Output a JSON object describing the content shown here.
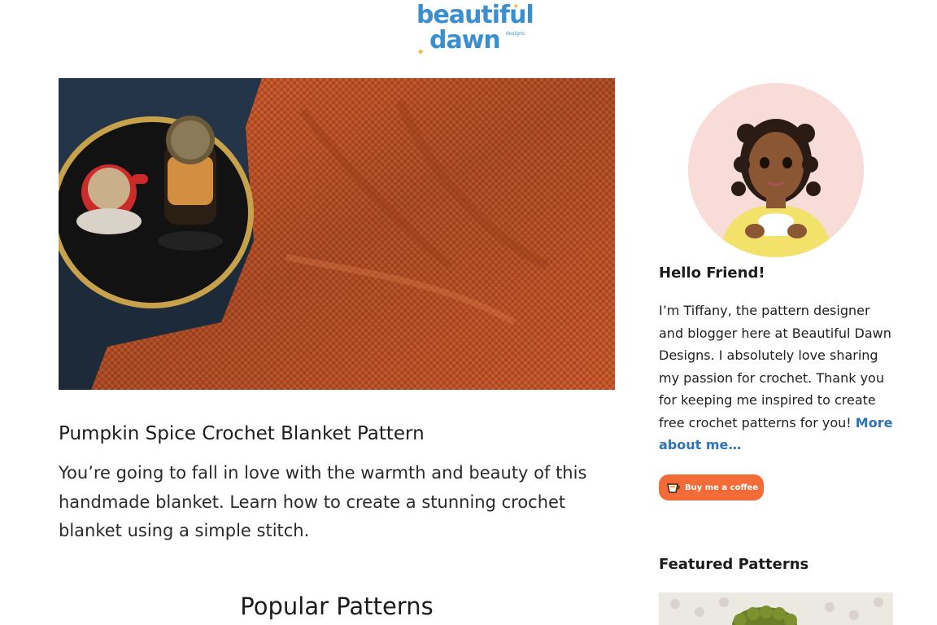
{
  "brand": {
    "logo_line1": "beautiful",
    "logo_line2": "dawn",
    "logo_small": "designs",
    "color": "#3a8fd0",
    "accent": "#f0b83a"
  },
  "post": {
    "title": "Pumpkin Spice Crochet Blanket Pattern",
    "excerpt": "You’re going to fall in love with the warmth and beauty of this handmade blanket. Learn how to create a stunning crochet blanket using a simple stitch.",
    "image_colors": {
      "blanket": "#c9572a",
      "tray": "#141414",
      "background": "#1d2a3a"
    }
  },
  "popular": {
    "heading": "Popular Patterns"
  },
  "sidebar": {
    "greeting": "Hello Friend!",
    "bio": "I’m Tiffany, the pattern designer and blogger here at Beautiful Dawn Designs. I absolutely love sharing my passion for crochet. Thank you for keeping me inspired to create free crochet patterns for you!",
    "more_link": "More about me…",
    "link_color": "#2f74b5",
    "coffee_button": "Buy me a coffee",
    "coffee_color": "#f36b36",
    "featured_heading": "Featured Patterns"
  }
}
